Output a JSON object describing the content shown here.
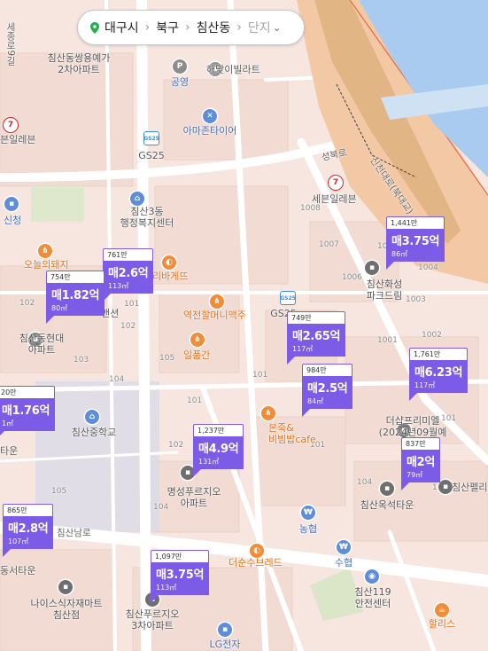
{
  "breadcrumb": {
    "region": "대구시",
    "district": "북구",
    "dong": "침산동",
    "type_label": "단지"
  },
  "colors": {
    "marker": "#7c5be6",
    "river": "#a9cbef",
    "rail": "#d8a66b"
  },
  "labels": {
    "apt_chimsan_ssangyong": "침산동쌍용예가\n2차아파트",
    "sejong_street": "세종로9길",
    "police": "공영",
    "haemaji_villa": "해맞이빌라트",
    "amazon_tire": "아마존타이어",
    "seven_eleven_left": "븐일레븐",
    "gs25_top": "GS25",
    "seongbuk_ro": "성북로",
    "seven_eleven_right": "세븐일레븐",
    "chimsan_welfare": "침산3동\n행정복지센터",
    "sinam": "신청",
    "bulk_1008": "1008",
    "bulk_1007": "1007",
    "bulk_1006": "1006",
    "bulk_1003": "1003",
    "oneul_pork": "오늘의돼지",
    "ribakets": "리바게뜨",
    "chimsan_hwaseong": "침산화성\n파크드림",
    "mansion": "맨션",
    "yeokjeon_halmeoni": "역전할머니맥주",
    "gs25_mid": "GS25",
    "chimsan_hyundai": "침산동현대\n아파트",
    "ilpumgan": "일품간",
    "b102_a": "102",
    "b103_a": "103",
    "b105": "105",
    "b104": "104",
    "b101_a": "101",
    "b101_b": "101",
    "b102_b": "102",
    "b103_b": "103",
    "b104_b": "104",
    "b101_c": "101",
    "bonjuk": "본죽&\n비빔밥cafe",
    "the_sharp": "더샵프리미엘\n(2024년09월예정)",
    "chimsan_school": "침산중학교",
    "myeongseong": "명성푸르지오\n아파트",
    "chimsan_oksuk": "침산옥석타운",
    "chimsanpel": "침산펠리",
    "nonghyup": "농협",
    "chimsannam": "침산남로",
    "seo_town": "동서타운",
    "the_soon": "더순수브레드",
    "suhyeop": "수협",
    "nike_chimsan": "나이스식자재마트\n침산점",
    "chimsan_prugio3": "침산푸르지오\n3차아파트",
    "chimsan119": "침산119\n안전센터",
    "hollys": "할리스",
    "lg": "LG전자",
    "tae_town": "타운",
    "station": "신천대로(북대교)",
    "b1002": "1002",
    "b1004": "1004",
    "b1005": "1005",
    "b1001": "1001",
    "b101_d": "101",
    "b102_c": "102",
    "b104_c": "104",
    "b101_e": "101",
    "b103_c": "103",
    "b105_b": "105"
  },
  "markers": [
    {
      "id": "m1",
      "count": "761만",
      "price": "매2.6억",
      "area": "113㎡"
    },
    {
      "id": "m2",
      "count": "754만",
      "price": "매1.82억",
      "area": "80㎡"
    },
    {
      "id": "m3",
      "count": "1,441만",
      "price": "매3.75억",
      "area": "86㎡"
    },
    {
      "id": "m4",
      "count": "749만",
      "price": "매2.65억",
      "area": "117㎡"
    },
    {
      "id": "m5",
      "count": "984만",
      "price": "매2.5억",
      "area": "84㎡"
    },
    {
      "id": "m6",
      "count": "1,761만",
      "price": "매6.23억",
      "area": "117㎡"
    },
    {
      "id": "m7",
      "count": "20만",
      "price": "매1.76억",
      "area": "1㎡"
    },
    {
      "id": "m8",
      "count": "1,237만",
      "price": "매4.9억",
      "area": "131㎡"
    },
    {
      "id": "m9",
      "count": "837만",
      "price": "매2억",
      "area": "79㎡"
    },
    {
      "id": "m10",
      "count": "865만",
      "price": "매2.8억",
      "area": "107㎡"
    },
    {
      "id": "m11",
      "count": "1,097만",
      "price": "매3.75억",
      "area": "113㎡"
    }
  ]
}
